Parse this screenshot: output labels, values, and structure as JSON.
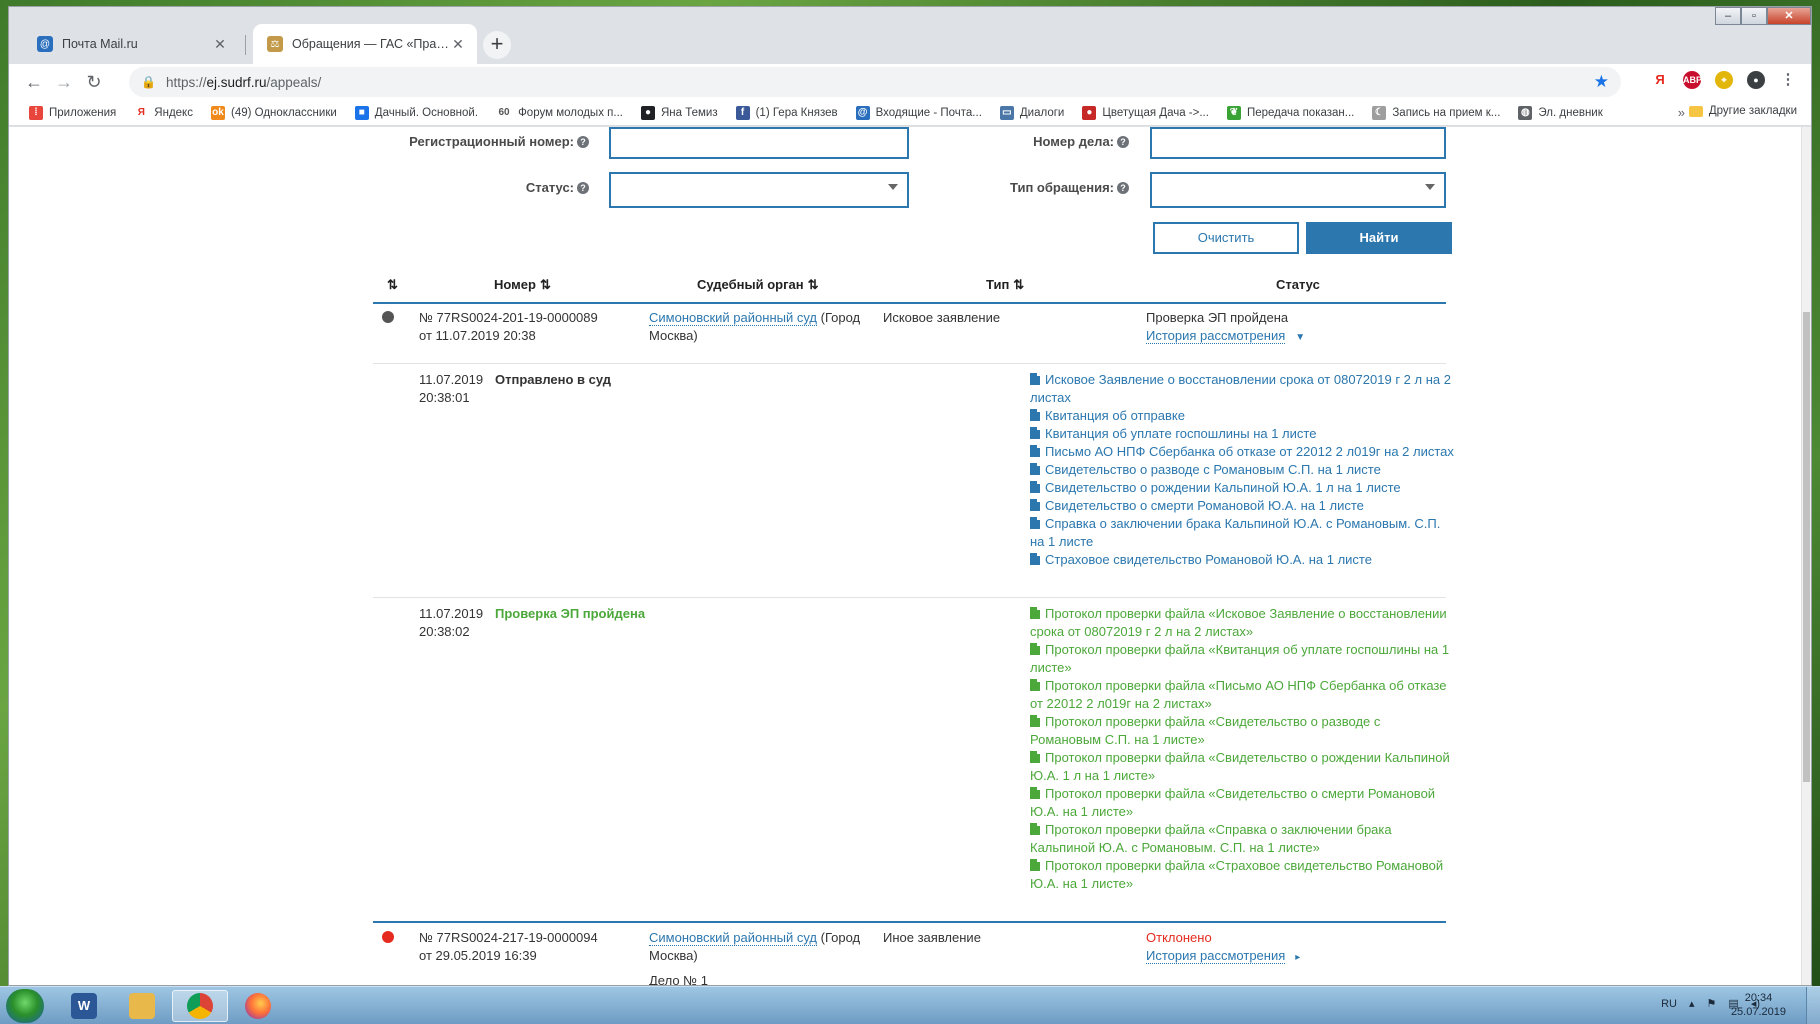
{
  "browser": {
    "tabs": [
      {
        "title": "Почта Mail.ru",
        "icon": "mail-ru-icon",
        "color": "#2a6fbd"
      },
      {
        "title": "Обращения — ГАС «Правосудие»",
        "icon": "scales-icon",
        "color": "#c39a4a"
      }
    ],
    "url_scheme": "https://",
    "url_host": "ej.sudrf.ru",
    "url_path": "/appeals/",
    "bookmarks": [
      {
        "label": "Приложения",
        "icon": "apps-grid-icon",
        "color": "#e8453c"
      },
      {
        "label": "Яндекс",
        "icon": "yandex-icon",
        "color": "#e52b1f"
      },
      {
        "label": "(49) Одноклассники",
        "icon": "odnoklassniki-icon",
        "color": "#f18a1c"
      },
      {
        "label": "Дачный. Основной.",
        "icon": "windows-icon",
        "color": "#1a73e8"
      },
      {
        "label": "Форум молодых п...",
        "icon": "number-60-icon",
        "color": "#555555"
      },
      {
        "label": "Яна Темиз",
        "icon": "spy-icon",
        "color": "#202124"
      },
      {
        "label": "(1) Гера Князев",
        "icon": "facebook-icon",
        "color": "#3b5998"
      },
      {
        "label": "Входящие - Почта...",
        "icon": "mail-ru-icon",
        "color": "#2a6fbd"
      },
      {
        "label": "Диалоги",
        "icon": "chat-icon",
        "color": "#4a76a8"
      },
      {
        "label": "Цветущая Дача ->...",
        "icon": "cherries-icon",
        "color": "#c62828"
      },
      {
        "label": "Передача показан...",
        "icon": "leaf-icon",
        "color": "#3aa336"
      },
      {
        "label": "Запись на прием к...",
        "icon": "moon-icon",
        "color": "#9e9e9e"
      },
      {
        "label": "Эл. дневник",
        "icon": "globe-icon",
        "color": "#5f6368"
      }
    ],
    "other_bookmarks": "Другие закладки"
  },
  "form": {
    "reg_number_label": "Регистрационный номер:",
    "case_number_label": "Номер дела:",
    "status_label": "Статус:",
    "appeal_type_label": "Тип обращения:",
    "help_glyph": "?",
    "clear_button": "Очистить",
    "find_button": "Найти"
  },
  "table": {
    "headers": {
      "sort": "",
      "number": "Номер",
      "court": "Судебный орган",
      "type": "Тип",
      "status": "Статус"
    },
    "sort_glyph": "⇅",
    "rows": [
      {
        "dot_color": "#555555",
        "number_line1": "№ 77RS0024-201-19-0000089",
        "number_line2": "от 11.07.2019 20:38",
        "court_link": "Симоновский районный суд",
        "court_suffix_1": " (Город",
        "court_suffix_2": "Москва)",
        "type": "Исковое заявление",
        "status": "Проверка ЭП пройдена",
        "history_link": "История рассмотрения",
        "history_arrow": "▼",
        "events": [
          {
            "date": "11.07.2019",
            "time": "20:38:01",
            "title": "Отправлено в суд",
            "documents": [
              "Исковое Заявление о восстановлении срока от 08072019 г 2 л на 2 листах",
              "Квитанция об отправке",
              "Квитанция об уплате госпошлины на 1 листе",
              "Письмо АО НПФ Сбербанка об отказе от 22012 2 л019г на 2 листах",
              "Свидетельство о разводе с Романовым С.П. на 1 листе",
              "Свидетельство о рождении Кальпиной Ю.А. 1 л на 1 листе",
              "Свидетельство о смерти Романовой Ю.А. на 1 листе",
              "Справка о заключении брака Кальпиной Ю.А. с Романовым. С.П. на 1 листе",
              "Страховое свидетельство Романовой Ю.А. на 1 листе"
            ]
          },
          {
            "date": "11.07.2019",
            "time": "20:38:02",
            "title": "Проверка ЭП пройдена",
            "documents": [
              "Протокол проверки файла «Исковое Заявление о восстановлении срока от 08072019 г 2 л на 2 листах»",
              "Протокол проверки файла «Квитанция об уплате госпошлины на 1 листе»",
              "Протокол проверки файла «Письмо АО НПФ Сбербанка об отказе от 22012 2 л019г на 2 листах»",
              "Протокол проверки файла «Свидетельство о разводе с Романовым С.П. на 1 листе»",
              "Протокол проверки файла «Свидетельство о рождении Кальпиной Ю.А. 1 л на 1 листе»",
              "Протокол проверки файла «Свидетельство о смерти Романовой Ю.А. на 1 листе»",
              "Протокол проверки файла «Справка о заключении брака Кальпиной Ю.А. с Романовым. С.П. на 1 листе»",
              "Протокол проверки файла «Страховое свидетельство Романовой Ю.А. на 1 листе»"
            ]
          }
        ]
      },
      {
        "dot_color": "#e52b1f",
        "number_line1": "№ 77RS0024-217-19-0000094",
        "number_line2": "от 29.05.2019 16:39",
        "court_link": "Симоновский районный суд",
        "court_suffix_1": " (Город",
        "court_suffix_2": "Москва)",
        "type": "Иное заявление",
        "status": "Отклонено",
        "history_link": "История рассмотрения",
        "history_arrow": "▸",
        "case_ref": "Дело № 1"
      }
    ]
  },
  "colors": {
    "accent": "#2b77ae",
    "success": "#4ca83a",
    "danger": "#e52b1f"
  },
  "taskbar": {
    "apps": [
      {
        "name": "word-icon",
        "glyph": "W",
        "color": "#2b5797"
      },
      {
        "name": "folder-icon",
        "glyph": "",
        "color": "#e8b94a"
      },
      {
        "name": "chrome-icon",
        "glyph": "",
        "color": "#db4437"
      },
      {
        "name": "firefox-icon",
        "glyph": "",
        "color": "#ff7139"
      }
    ],
    "language": "RU",
    "time": "20:34",
    "date": "25.07.2019"
  }
}
